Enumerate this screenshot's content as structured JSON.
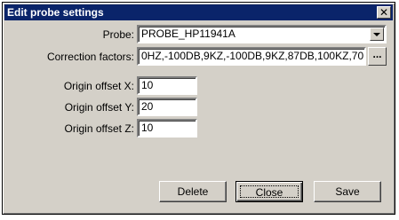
{
  "window": {
    "title": "Edit probe settings",
    "close_label": "✕"
  },
  "probe": {
    "label": "Probe:",
    "value": "PROBE_HP11941A"
  },
  "correction": {
    "label": "Correction factors:",
    "value": "0HZ,-100DB,9KZ,-100DB,9KZ,87DB,100KZ,70",
    "browse_label": "..."
  },
  "origin_x": {
    "label": "Origin offset X:",
    "value": "10"
  },
  "origin_y": {
    "label": "Origin offset Y:",
    "value": "20"
  },
  "origin_z": {
    "label": "Origin offset Z:",
    "value": "10"
  },
  "buttons": {
    "delete": "Delete",
    "close": "Close",
    "save": "Save"
  },
  "colors": {
    "titlebar": "#0a246a",
    "face": "#d4d0c8"
  }
}
